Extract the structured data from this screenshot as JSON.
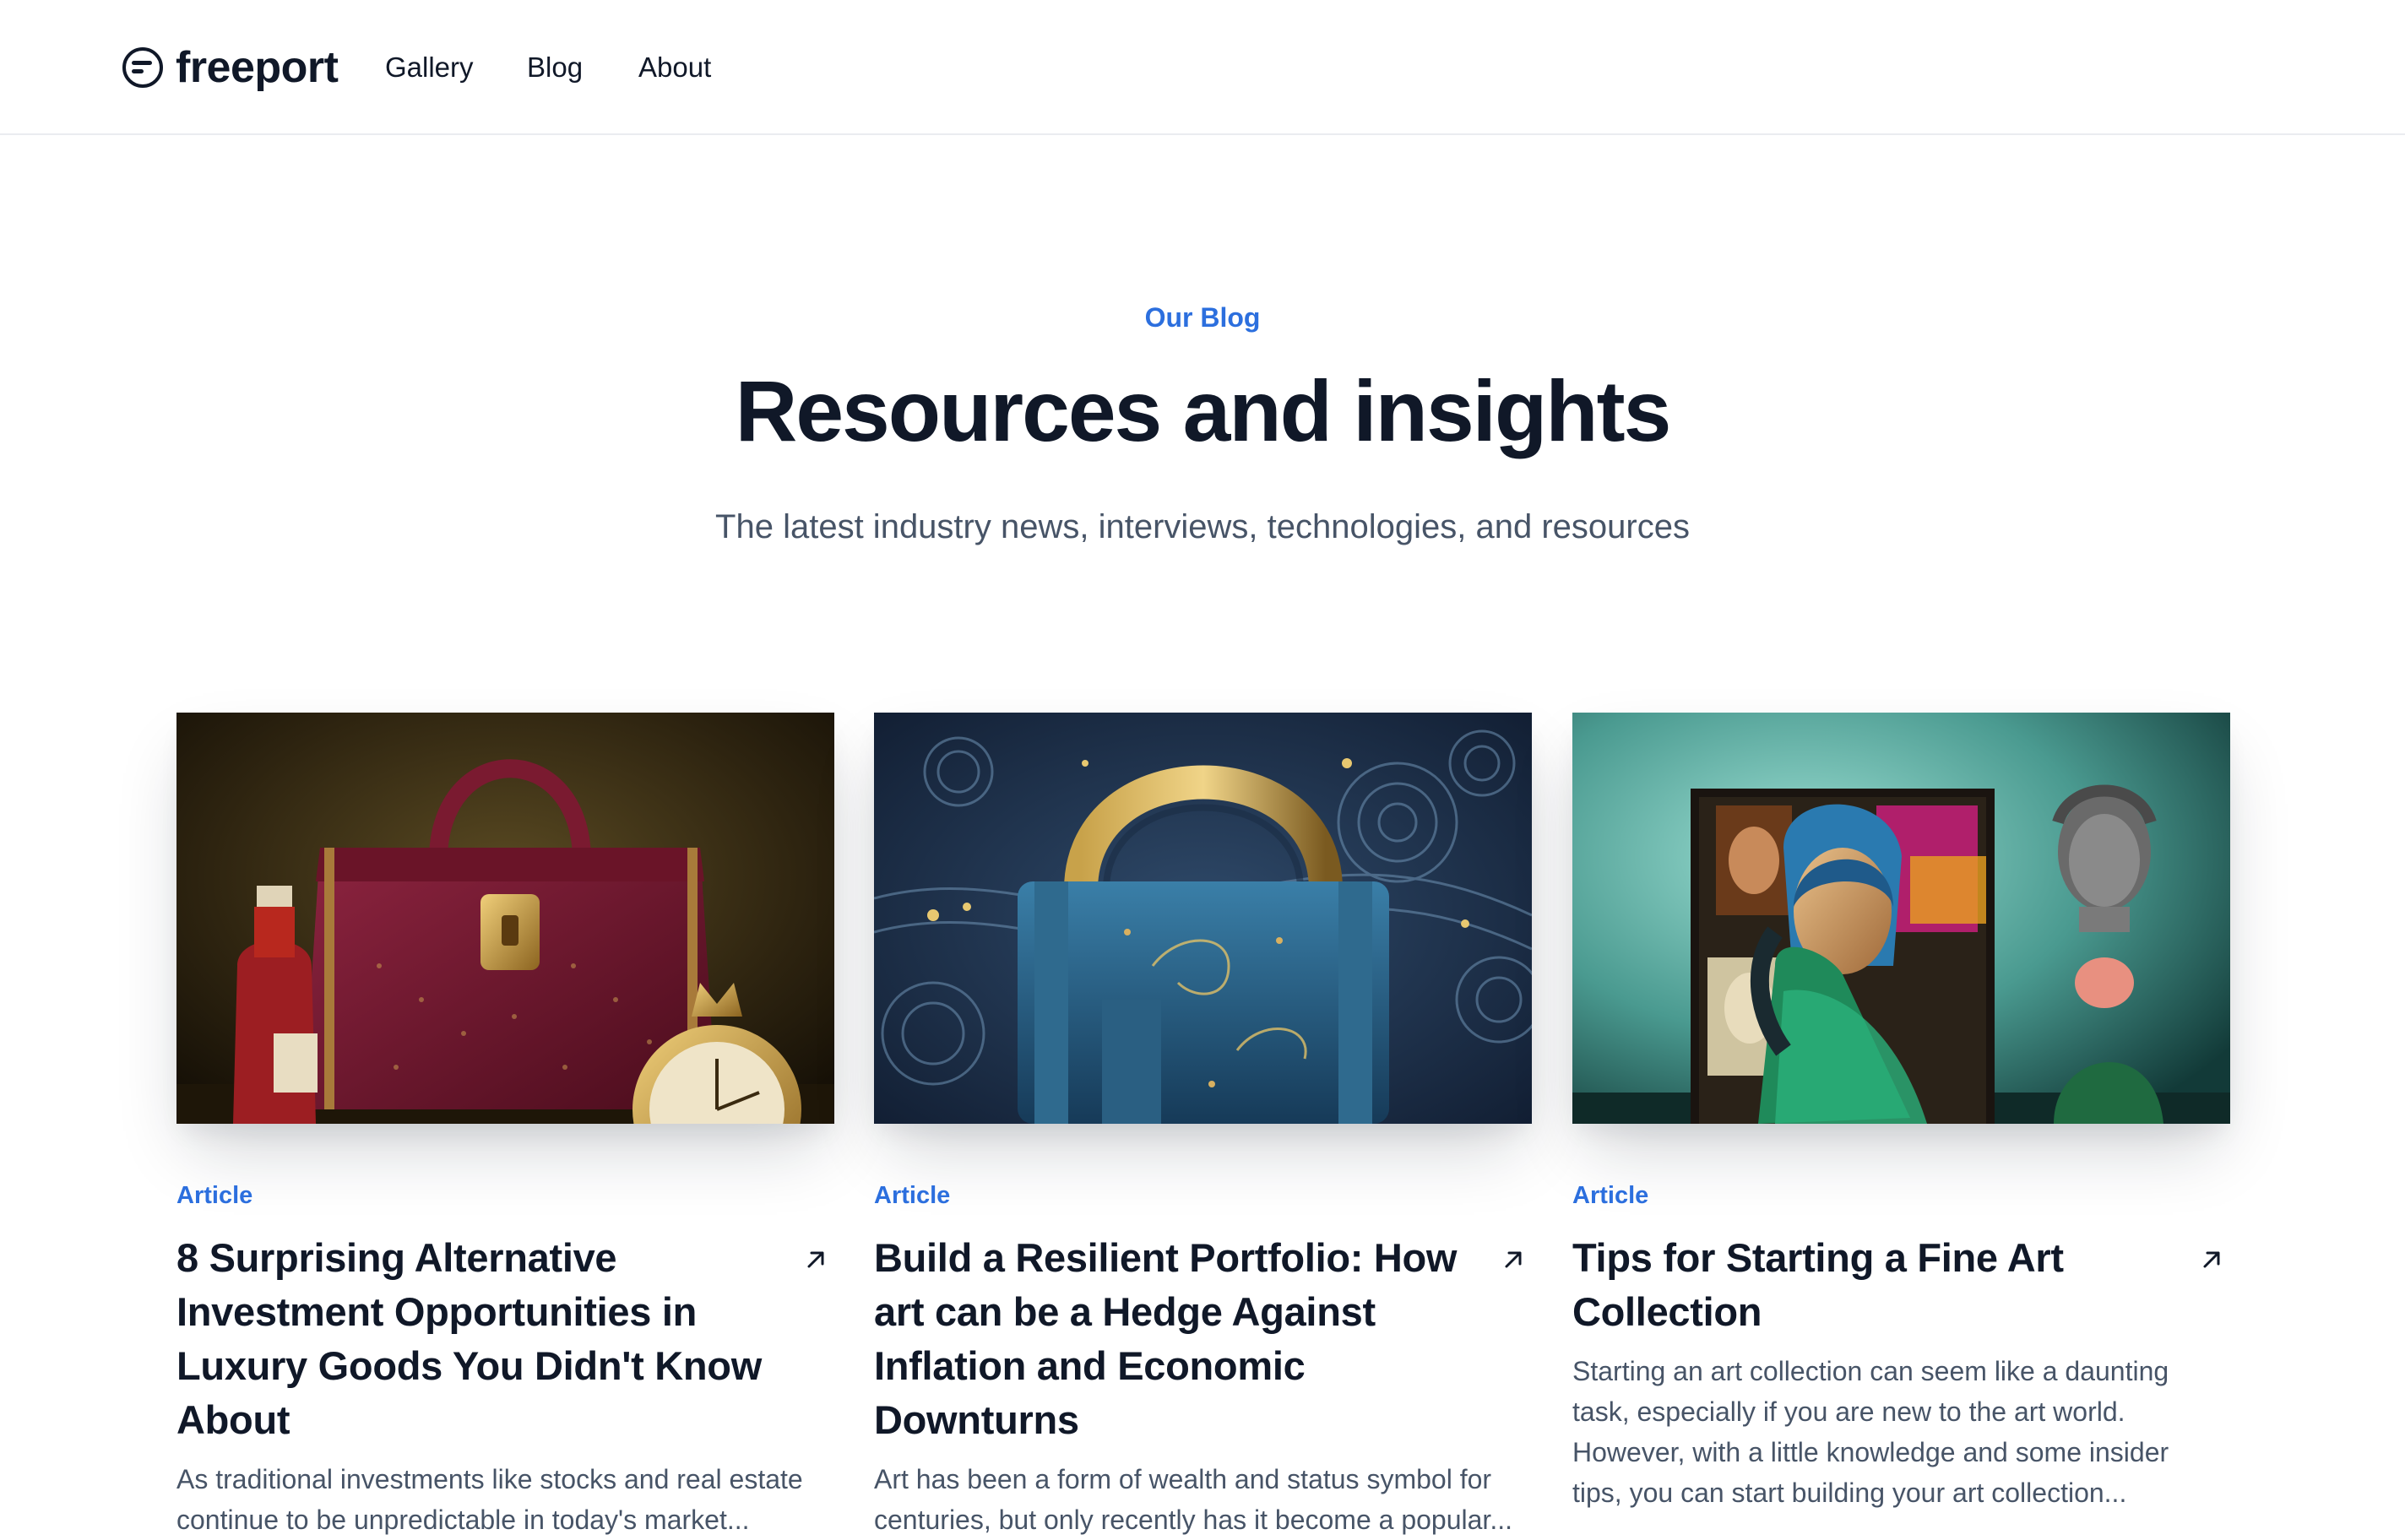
{
  "brand": {
    "name": "freeport",
    "logo_icon": "freeport-logo-icon"
  },
  "nav": {
    "items": [
      {
        "label": "Gallery"
      },
      {
        "label": "Blog"
      },
      {
        "label": "About"
      }
    ]
  },
  "hero": {
    "eyebrow": "Our Blog",
    "title": "Resources and insights",
    "subtitle": "The latest industry news, interviews, technologies, and resources"
  },
  "colors": {
    "accent": "#2c6fde",
    "heading": "#101828",
    "body": "#475467"
  },
  "posts": [
    {
      "tag": "Article",
      "title": "8 Surprising Alternative Investment Opportunities in Luxury Goods You Didn't Know About",
      "excerpt": "As traditional investments like stocks and real estate continue to be unpredictable in today's market...",
      "image": "luxury-handbag-wine-clock-image",
      "arrow_icon": "arrow-up-right-icon"
    },
    {
      "tag": "Article",
      "title": "Build a Resilient Portfolio: How art can be a Hedge Against Inflation and Economic Downturns",
      "excerpt": "Art has been a form of wealth and status symbol for centuries, but only recently has it become a popular...",
      "image": "starry-night-padlock-image",
      "arrow_icon": "arrow-up-right-icon"
    },
    {
      "tag": "Article",
      "title": "Tips for Starting a Fine Art Collection",
      "excerpt": "Starting an art collection can seem like a daunting task, especially if you are new to the art world. However, with a little knowledge and some insider tips, you can start building your art collection...",
      "image": "fine-art-collage-bust-image",
      "arrow_icon": "arrow-up-right-icon"
    }
  ]
}
